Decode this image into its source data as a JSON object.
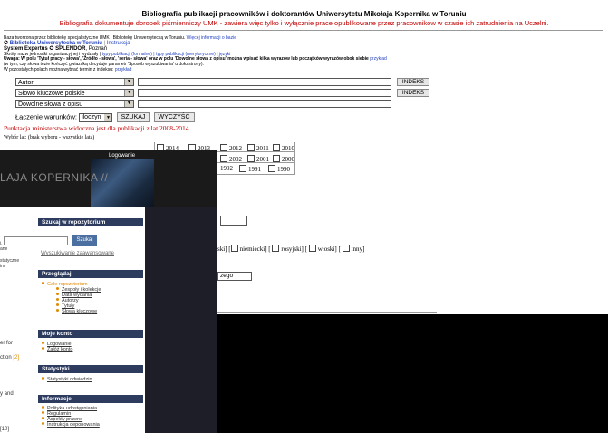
{
  "top": {
    "title": "Bibliografia publikacji pracowników i doktorantów Uniwersytetu Mikołaja Kopernika w Toruniu",
    "subtitle": "Bibliografia dokumentuje dorobek piśmienniczy UMK - zawiera więc tylko i wyłącznie prace opublikowane przez pracowników w czasie ich zatrudnienia na Uczelni.",
    "note_line1_a": "Baza tworzona przez bibliotekę specjalistyczne UMK i Bibliotekę Uniwersytecką w Toruniu.",
    "note_line1_link": "Więcej informacji o bazie",
    "libs_link": "Biblioteka Uniwersytecka w Toruniu",
    "instr_link": "Instrukcja",
    "system_a": "System Expertus",
    "system_b": "SPLENDOR",
    "system_c": ", Poznań",
    "note_line3_a": "Skróty nazw jednostki organizacyjnej i wydziały |",
    "note_line3_link": "typy publikacji (formalne) | typy publikacji (merytoryczne) | języki",
    "note_line4": "Uwaga: W polu 'Tytuł pracy - słowa', 'Źródło - słowa', 'seria - słowa' oraz w polu 'Dowolne słowa z opisu' można wpisać kilka wyrazów lub początków wyrazów obok siebie",
    "note_line4_link": "przykład",
    "note_line5": "(w tym, czy słowa tezie kończyć gwiazdką decyduje parametr 'Sposób wyszukiwania' u dołu strony).",
    "note_line6": "W pozostałych polach można wybrać termin z indeksu:",
    "note_line6_link": "przykład",
    "search_rows": [
      {
        "field": "Autor",
        "value": "",
        "button": "INDEKS"
      },
      {
        "field": "Słowo kluczowe polskie",
        "value": "",
        "button": "INDEKS"
      },
      {
        "field": "Dowolne słowa z opisu",
        "value": ""
      }
    ],
    "join_label": "Łączenie warunków:",
    "join_value": "iloczyn",
    "search_btn": "SZUKAJ",
    "clear_btn": "WYCZYŚĆ",
    "points_note": "Punktacja ministerstwa widoczna jest dla publikacji z lat 2008-2014",
    "years_label": "Wybór lat: (brak wyboru - wszystkie lata)",
    "years_row1": [
      "2014",
      "2013",
      "2012",
      "2011",
      "2010"
    ],
    "years_row2": [
      "2002",
      "2001",
      "2000"
    ],
    "years_row3": [
      "1992",
      "1991",
      "1990"
    ],
    "lang_fragment_a": "ski] [",
    "lang_niem": "niemiecki] [",
    "lang_ros": "rosyjski] [",
    "lang_wlo": "włoski] [",
    "lang_inny": "inny]",
    "order_fragment": "zego"
  },
  "back": {
    "banner_title": "LAJA KOPERNIKA //",
    "login": "Logowanie",
    "left_texts": [
      "i, które są",
      "ane",
      "statyczne",
      "im",
      "er for",
      "ction",
      "y and"
    ],
    "left_count_1": "[2]",
    "left_count_2": "[10]",
    "repo_header": "Szukaj w repozytorium",
    "repo_btn": "Szukaj",
    "repo_adv": "Wyszukiwanie zaawansowane",
    "browse_header": "Przeglądaj",
    "browse_top": "Całe repozytorium",
    "browse_items": [
      "Zespoły i kolekcje",
      "Data wydania",
      "Autorzy",
      "Tytuły",
      "Słowa kluczowe"
    ],
    "account_header": "Moje konto",
    "account_items": [
      "Logowanie",
      "Załóż konto"
    ],
    "stats_header": "Statystyki",
    "stats_items": [
      "Statystyki odwiedzin"
    ],
    "info_header": "Informacje",
    "info_items": [
      "Polityka udostępniania",
      "Regulamin",
      "Aspekty prawne",
      "Instrukcja deponowania"
    ]
  }
}
